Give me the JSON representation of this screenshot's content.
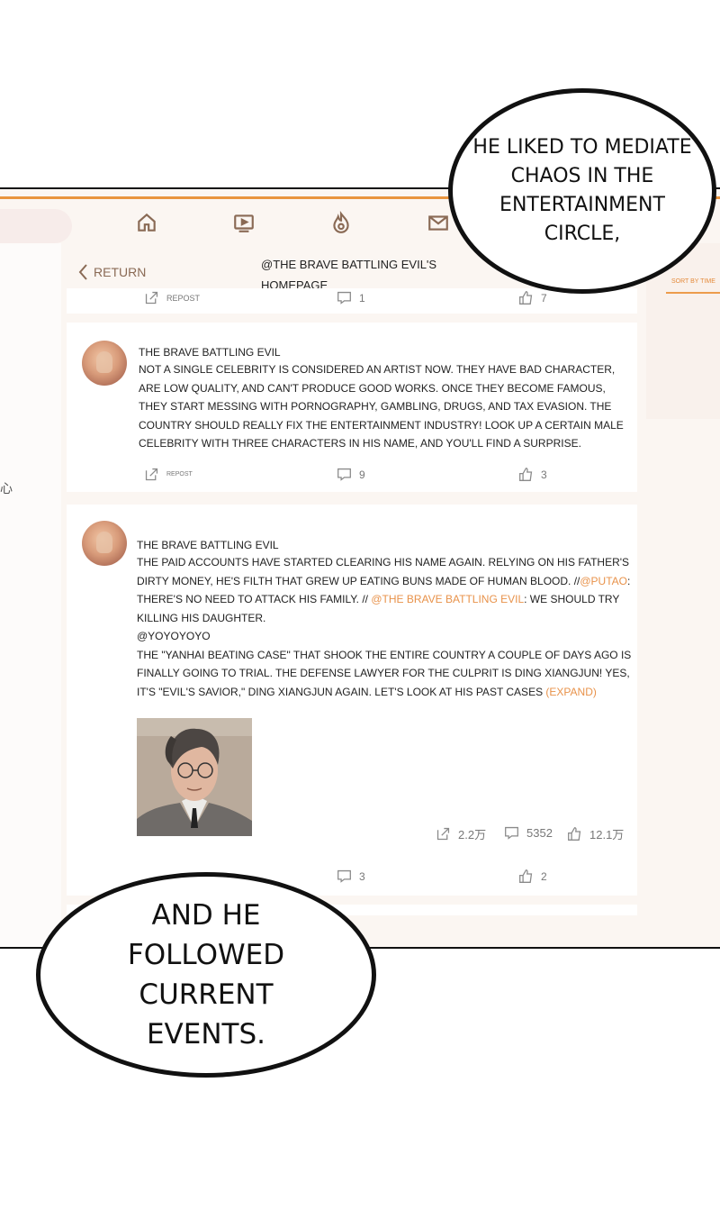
{
  "header": {
    "return_label": "RETURN",
    "homepage_title": "@THE BRAVE BATTLING EVIL'S HOMEPAGE",
    "sort_label": "SORT BY TIME",
    "left_glyph": "心",
    "nav_icons": [
      "home-icon",
      "video-icon",
      "fire-icon",
      "mail-icon"
    ]
  },
  "top_partial": {
    "repost": "REPOST",
    "comments": "1",
    "likes": "7"
  },
  "post1": {
    "username": "THE BRAVE BATTLING EVIL",
    "text": "NOT A SINGLE CELEBRITY IS CONSIDERED AN ARTIST NOW. THEY HAVE BAD CHARACTER, ARE LOW QUALITY, AND CAN'T PRODUCE GOOD WORKS. ONCE THEY BECOME FAMOUS, THEY START MESSING WITH PORNOGRAPHY, GAMBLING, DRUGS, AND TAX EVASION. THE COUNTRY SHOULD REALLY FIX THE ENTERTAINMENT INDUSTRY! LOOK UP A CERTAIN MALE CELEBRITY WITH THREE CHARACTERS IN HIS NAME, AND YOU'LL FIND A SURPRISE.",
    "repost": "REPOST",
    "comments": "9",
    "likes": "3"
  },
  "post2": {
    "username": "THE BRAVE BATTLING EVIL",
    "line1": "THE PAID ACCOUNTS HAVE STARTED CLEARING HIS NAME AGAIN. RELYING ON HIS FATHER'S DIRTY MONEY, HE'S FILTH THAT GREW UP EATING BUNS MADE OF HUMAN BLOOD. //",
    "mention1": "@PUTAO",
    "line2": ": THERE'S NO NEED TO ATTACK HIS FAMILY. // ",
    "mention2": "@THE BRAVE BATTLING EVIL",
    "line3": ": WE SHOULD TRY KILLING HIS DAUGHTER.",
    "quoted_user": "@YOYOYOYO",
    "quoted_text": "THE \"YANHAI BEATING CASE\" THAT SHOOK THE ENTIRE COUNTRY A COUPLE OF DAYS AGO IS FINALLY GOING TO TRIAL. THE DEFENSE LAWYER FOR THE CULPRIT IS DING XIANGJUN! YES, IT'S \"EVIL'S SAVIOR,\" DING XIANGJUN AGAIN. LET'S LOOK AT HIS PAST CASES ",
    "expand": "(EXPAND)",
    "inner_reposts": "2.2万",
    "inner_comments": "5352",
    "inner_likes": "12.1万",
    "comments": "3",
    "likes": "2"
  },
  "bubbles": {
    "top": "HE LIKED TO MEDIATE CHAOS IN THE ENTERTAINMENT CIRCLE,",
    "bottom": "AND HE FOLLOWED CURRENT EVENTS."
  },
  "colors": {
    "accent": "#e9953e",
    "mention": "#e8924a",
    "icon": "#8a6a55"
  }
}
